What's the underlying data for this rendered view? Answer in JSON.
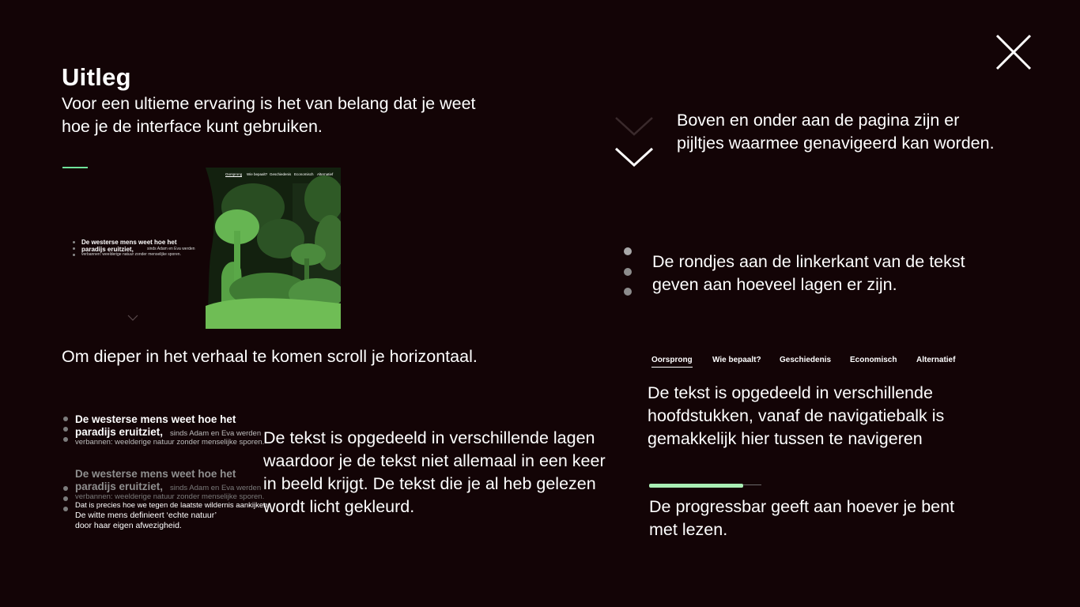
{
  "header": {
    "title": "Uitleg",
    "intro": "Voor een ultieme ervaring is het van belang dat je weet hoe je de interface kunt gebruiken."
  },
  "close_icon": "close-icon",
  "colors": {
    "background": "#130406",
    "accent_green": "#6fe39a",
    "progress_green": "#a9efb4",
    "dot_grey": "#8c8c8c"
  },
  "scroll_demo": {
    "mini_heading_1": "De westerse mens weet hoe het",
    "mini_heading_2": "paradijs eruitziet,",
    "mini_small_1": "sinds Adam en Eva werden",
    "mini_small_2": "verbannen: weelderige natuur zonder menselijke sporen.",
    "forest_nav": [
      "Oorsprong",
      "Wie bepaalt?",
      "Geschiedenis",
      "Economisch",
      "Alternatief"
    ],
    "caption": "Om dieper in het verhaal te komen scroll je horizontaal."
  },
  "layers_demo": {
    "block1": {
      "heading_1": "De westerse mens weet hoe het",
      "heading_2": "paradijs eruitziet,",
      "small_1": "sinds Adam en Eva werden",
      "small_2": "verbannen: weelderige natuur zonder menselijke sporen."
    },
    "block2": {
      "heading_1": "De westerse mens weet hoe het",
      "heading_2": "paradijs eruitziet,",
      "small_1": "sinds Adam en Eva werden",
      "small_2": "verbannen: weelderige natuur zonder menselijke sporen.",
      "line_3": "Dat is precies hoe we tegen de laatste wildernis aankijken.",
      "line_4": "De witte mens definieert ‘echte natuur’",
      "line_5": "door haar eigen afwezigheid."
    },
    "caption": "De tekst is opgedeeld in verschillende lagen waardoor je de tekst niet allemaal in een keer in beeld krijgt. De tekst die je al heb gelezen wordt licht gekleurd."
  },
  "arrows_demo": {
    "caption": "Boven en onder aan de pagina zijn er pijltjes waarmee genavigeerd kan worden."
  },
  "dots_demo": {
    "caption": "De rondjes aan de linkerkant van de tekst geven aan hoeveel lagen er zijn."
  },
  "nav_demo": {
    "items": [
      "Oorsprong",
      "Wie bepaalt?",
      "Geschiedenis",
      "Economisch",
      "Alternatief"
    ],
    "active": "Oorsprong",
    "caption": "De tekst is opgedeeld in verschillende hoofdstukken, vanaf de navigatiebalk is gemakkelijk hier tussen te navigeren"
  },
  "progress_demo": {
    "progress": 0.84,
    "caption": "De progressbar geeft aan hoever je bent met lezen."
  }
}
